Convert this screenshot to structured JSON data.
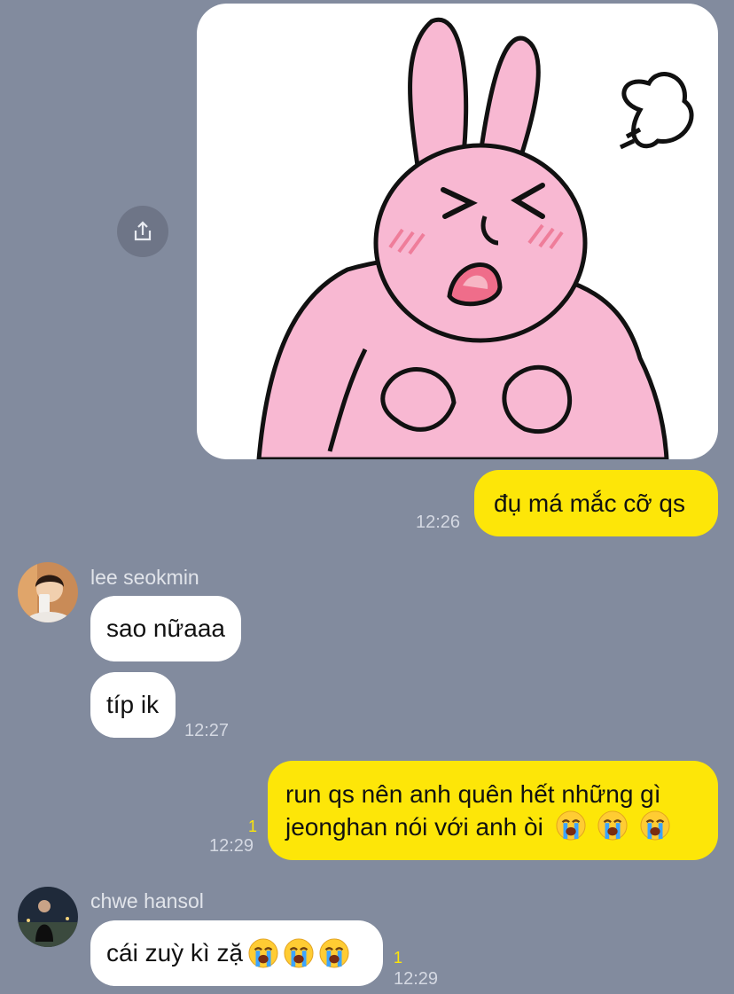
{
  "messages": {
    "sticker": {
      "icon": "angry-pink-bunny-sticker",
      "share_icon": "share-icon"
    },
    "m1": {
      "text": "đụ má mắc cỡ qs",
      "time": "12:26"
    },
    "lee": {
      "name": "lee seokmin",
      "m1": {
        "text": "sao nữaaa"
      },
      "m2": {
        "text": "típ ik",
        "time": "12:27"
      }
    },
    "m2": {
      "line1": "run qs nên anh quên hết những gì",
      "line2": "jeonghan nói với anh òi",
      "read": "1",
      "time": "12:29"
    },
    "chwe": {
      "name": "chwe hansol",
      "m1": {
        "text": "cái zuỳ kì zặ",
        "read": "1",
        "time": "12:29"
      }
    }
  },
  "colors": {
    "background": "#828b9e",
    "my_bubble": "#fde608",
    "their_bubble": "#ffffff",
    "read_count": "#fde608"
  },
  "emoji": "loudly-crying-face"
}
